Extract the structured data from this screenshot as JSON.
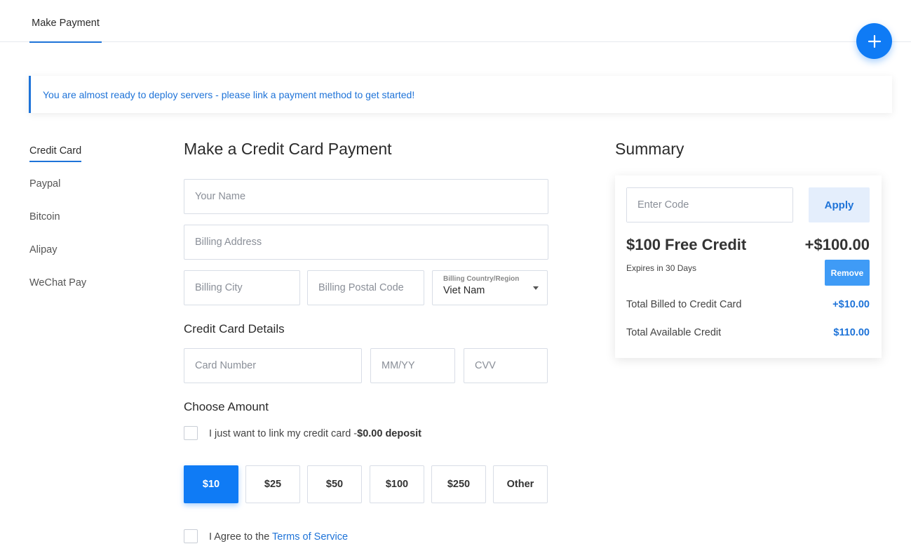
{
  "topbar": {
    "tab_label": "Make Payment"
  },
  "notice": {
    "text": "You are almost ready to deploy servers - please link a payment method to get started!"
  },
  "side_menu": {
    "items": [
      "Credit Card",
      "Paypal",
      "Bitcoin",
      "Alipay",
      "WeChat Pay"
    ],
    "active": "Credit Card"
  },
  "form": {
    "title": "Make a Credit Card Payment",
    "name_placeholder": "Your Name",
    "address_placeholder": "Billing Address",
    "city_placeholder": "Billing City",
    "postal_placeholder": "Billing Postal Code",
    "country_label": "Billing Country/Region",
    "country_value": "Viet Nam",
    "card_section": "Credit Card Details",
    "card_number_placeholder": "Card Number",
    "expiry_placeholder": "MM/YY",
    "cvv_placeholder": "CVV",
    "amount_section": "Choose Amount",
    "link_only_text": "I just want to link my credit card -",
    "link_only_bold": "$0.00 deposit",
    "amounts": [
      "$10",
      "$25",
      "$50",
      "$100",
      "$250",
      "Other"
    ],
    "selected_amount": "$10",
    "agree_text": "I Agree to the ",
    "agree_link": "Terms of Service"
  },
  "summary": {
    "title": "Summary",
    "code_placeholder": "Enter Code",
    "apply_label": "Apply",
    "credit_title": "$100 Free Credit",
    "credit_amount": "+$100.00",
    "expires": "Expires in 30 Days",
    "remove_label": "Remove",
    "billed_label": "Total Billed to Credit Card",
    "billed_value": "+$10.00",
    "available_label": "Total Available Credit",
    "available_value": "$110.00"
  },
  "colors": {
    "accent": "#0f7bf5",
    "link": "#1e73d8",
    "apply_bg": "#e4eefc",
    "remove_bg": "#3f9bf6"
  }
}
